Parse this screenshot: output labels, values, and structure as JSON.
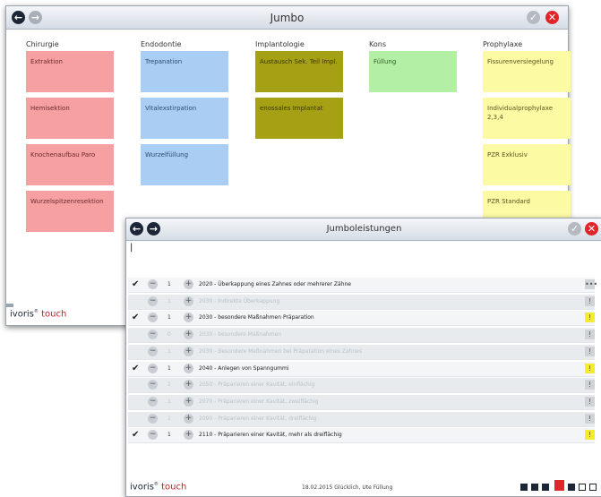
{
  "jumbo": {
    "title": "Jumbo",
    "brand": "ivoris",
    "brand2": "touch",
    "columns": [
      {
        "header": "Chirurgie",
        "tiles": [
          "Extraktion",
          "Hemisektion",
          "Knochenaufbau Paro",
          "Wurzelspitzenresektion"
        ]
      },
      {
        "header": "Endodontie",
        "tiles": [
          "Trepanation",
          "Vitalexstirpation",
          "Wurzelfüllung"
        ]
      },
      {
        "header": "Implantologie",
        "tiles": [
          "Austausch Sek. Teil Impl.",
          "enossales Implantat"
        ]
      },
      {
        "header": "Kons",
        "tiles": [
          "Füllung"
        ]
      },
      {
        "header": "Prophylaxe",
        "tiles": [
          "Fissurenversiegelung",
          "Individualprophylaxe 2,3,4",
          "PZR Exklusiv",
          "PZR Standard"
        ]
      }
    ],
    "colors": {
      "red": "#f6a0a2",
      "blue": "#a9cdf3",
      "olive": "#a6a014",
      "green": "#b3f0a6",
      "yellow": "#fdfaa4"
    }
  },
  "leistungen": {
    "title": "Jumboleistungen",
    "input_value": "|",
    "brand": "ivoris",
    "brand2": "touch",
    "status_text": "18.02.2015 Glücklich, Ute  Füllung",
    "rows": [
      {
        "checked": true,
        "qty": "1",
        "label": "2020 - Überkappung eines Zahnes oder mehrerer Zähne",
        "active": true,
        "flag": "•••"
      },
      {
        "checked": false,
        "qty": "1",
        "label": "2030 - Indirekte Überkappung",
        "active": false,
        "flag": "!"
      },
      {
        "checked": true,
        "qty": "1",
        "label": "2030 - besondere Maßnahmen Präparation",
        "active": true,
        "flag": "!"
      },
      {
        "checked": false,
        "qty": "0",
        "label": "2030 - besondere Maßnahmen",
        "active": false,
        "flag": "!"
      },
      {
        "checked": false,
        "qty": "1",
        "label": "2030 - Besondere Maßnahmen bei Präparation eines Zahnes",
        "active": false,
        "flag": "!"
      },
      {
        "checked": true,
        "qty": "1",
        "label": "2040 - Anlegen von Spanngummi",
        "active": true,
        "flag": "!"
      },
      {
        "checked": false,
        "qty": "1",
        "label": "2050 - Präparieren einer Kavität, einflächig",
        "active": false,
        "flag": "!"
      },
      {
        "checked": false,
        "qty": "1",
        "label": "2070 - Präparieren einer Kavität, zweiflächig",
        "active": false,
        "flag": "!"
      },
      {
        "checked": false,
        "qty": "1",
        "label": "2090 - Präparieren einer Kavität, dreiflächig",
        "active": false,
        "flag": "!"
      },
      {
        "checked": true,
        "qty": "1",
        "label": "2110 - Präparieren einer Kavität, mehr als dreiflächig",
        "active": true,
        "flag": "!"
      }
    ]
  }
}
